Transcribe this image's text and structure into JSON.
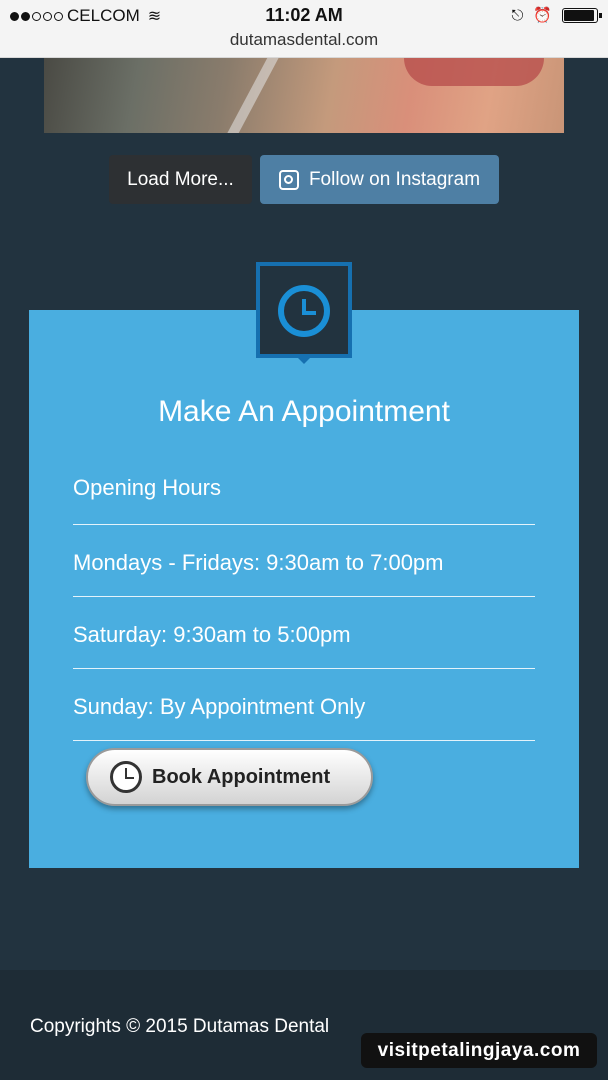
{
  "status_bar": {
    "carrier": "CELCOM",
    "signal_bars_filled": 2,
    "signal_bars_total": 5,
    "time": "11:02 AM",
    "url": "dutamasdental.com",
    "battery_level": 0.95
  },
  "gallery": {
    "load_more_label": "Load More...",
    "follow_label": "Follow on Instagram"
  },
  "appointment": {
    "title": "Make An Appointment",
    "rows": [
      "Opening Hours",
      "Mondays - Fridays: 9:30am to 7:00pm",
      "Saturday: 9:30am to 5:00pm",
      "Sunday: By Appointment Only"
    ],
    "book_label": "Book Appointment"
  },
  "footer": {
    "copyright": "Copyrights © 2015 Dutamas Dental",
    "watermark": "visitpetalingjaya.com"
  },
  "colors": {
    "page_bg": "#22333f",
    "card_bg": "#4aaee0",
    "instagram_button": "#4e7fa4",
    "load_more_button": "#2d3033",
    "clock_accent": "#1a8fd6"
  }
}
